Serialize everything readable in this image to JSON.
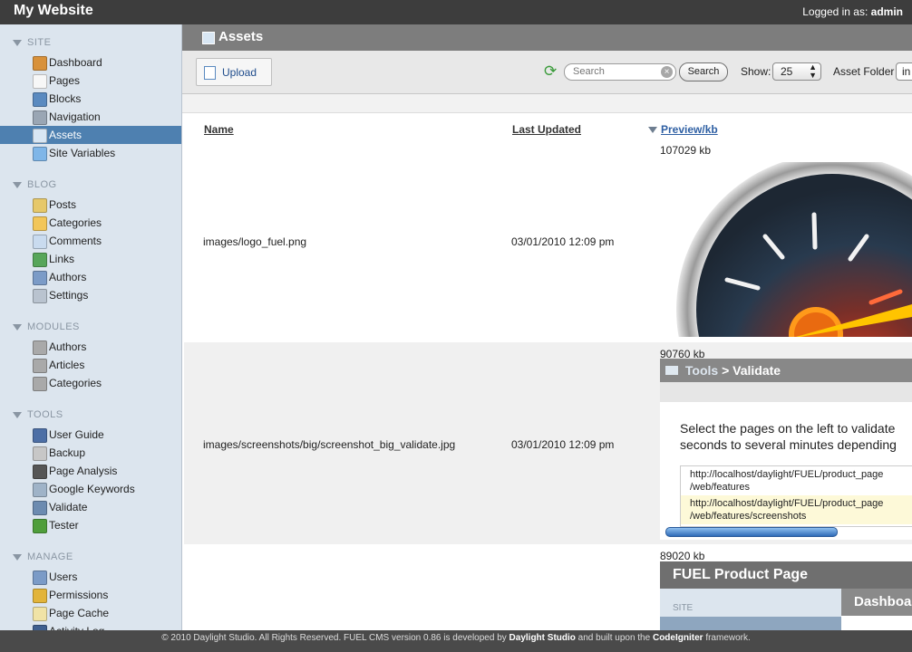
{
  "header": {
    "site_title": "My Website",
    "logged_in_label": "Logged in as:",
    "username": "admin"
  },
  "sidebar": {
    "sections": [
      {
        "title": "SITE",
        "items": [
          {
            "label": "Dashboard",
            "icon": "house-icon"
          },
          {
            "label": "Pages",
            "icon": "pages-icon"
          },
          {
            "label": "Blocks",
            "icon": "blocks-icon"
          },
          {
            "label": "Navigation",
            "icon": "navigation-icon"
          },
          {
            "label": "Assets",
            "icon": "assets-icon",
            "active": true
          },
          {
            "label": "Site Variables",
            "icon": "site-variables-icon"
          }
        ]
      },
      {
        "title": "BLOG",
        "items": [
          {
            "label": "Posts",
            "icon": "pencil-icon"
          },
          {
            "label": "Categories",
            "icon": "folder-icon"
          },
          {
            "label": "Comments",
            "icon": "speech-bubble-icon"
          },
          {
            "label": "Links",
            "icon": "globe-icon"
          },
          {
            "label": "Authors",
            "icon": "user-icon"
          },
          {
            "label": "Settings",
            "icon": "settings-icon"
          }
        ]
      },
      {
        "title": "MODULES",
        "items": [
          {
            "label": "Authors",
            "icon": "gear-icon"
          },
          {
            "label": "Articles",
            "icon": "gear-icon"
          },
          {
            "label": "Categories",
            "icon": "gear-icon"
          }
        ]
      },
      {
        "title": "TOOLS",
        "items": [
          {
            "label": "User Guide",
            "icon": "book-icon"
          },
          {
            "label": "Backup",
            "icon": "drive-icon"
          },
          {
            "label": "Page Analysis",
            "icon": "binoculars-icon"
          },
          {
            "label": "Google Keywords",
            "icon": "magnifier-icon"
          },
          {
            "label": "Validate",
            "icon": "html-icon"
          },
          {
            "label": "Tester",
            "icon": "bug-icon"
          }
        ]
      },
      {
        "title": "MANAGE",
        "items": [
          {
            "label": "Users",
            "icon": "user-icon"
          },
          {
            "label": "Permissions",
            "icon": "key-icon"
          },
          {
            "label": "Page Cache",
            "icon": "page-cache-icon"
          },
          {
            "label": "Activity Log",
            "icon": "log-book-icon"
          }
        ]
      }
    ]
  },
  "main": {
    "title": "Assets",
    "toolbar": {
      "upload_label": "Upload",
      "search_placeholder": "Search",
      "search_button": "Search",
      "show_label": "Show:",
      "show_value": "25",
      "folder_label": "Asset Folder",
      "folder_value": "in"
    },
    "table": {
      "columns": {
        "name": "Name",
        "updated": "Last Updated",
        "preview": "Preview/kb"
      },
      "rows": [
        {
          "name": "images/logo_fuel.png",
          "updated": "03/01/2010 12:09 pm",
          "size": "107029 kb"
        },
        {
          "name": "images/screenshots/big/screenshot_big_validate.jpg",
          "updated": "03/01/2010 12:09 pm",
          "size": "90760 kb",
          "preview": {
            "header_tools": "Tools",
            "header_sep": ">",
            "header_validate": "Validate",
            "text_line1": "Select the pages on the left to validate",
            "text_line2": "seconds to several minutes depending",
            "url1_a": "http://localhost/daylight/FUEL/product_page",
            "url1_b": "/web/features",
            "url2_a": "http://localhost/daylight/FUEL/product_page",
            "url2_b": "/web/features/screenshots"
          }
        },
        {
          "name": "",
          "updated": "",
          "size": "89020 kb",
          "preview": {
            "title": "FUEL Product Page",
            "site_label": "SITE",
            "dashboard_label": "Dashboa"
          }
        }
      ]
    }
  },
  "footer": {
    "copyright": "© 2010 Daylight Studio. All Rights Reserved. FUEL CMS version 0.86 is developed by",
    "developer": "Daylight Studio",
    "middle": "and built upon the",
    "framework_name": "CodeIgniter",
    "end": "framework."
  },
  "colors": {
    "topbar": "#3d3d3d",
    "sidebar_bg": "#dce5ee",
    "active_item": "#4e80b0",
    "header_gray": "#7d7d7d",
    "link_blue": "#2e5fa3"
  }
}
